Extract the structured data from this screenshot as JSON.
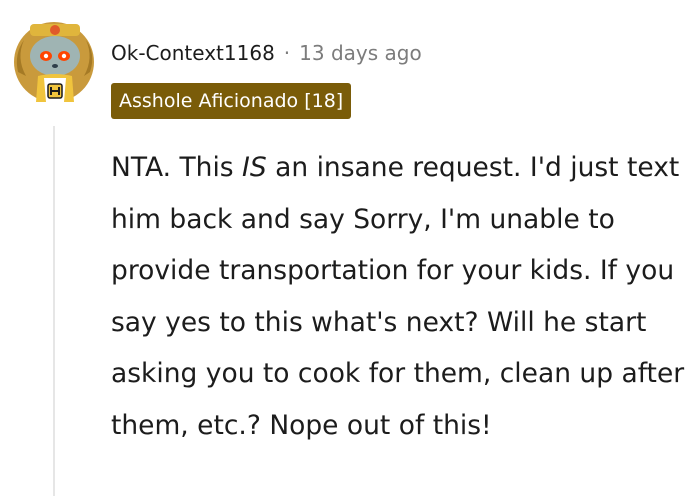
{
  "comment": {
    "author": "Ok-Context1168",
    "separator": "·",
    "timestamp": "13 days ago",
    "flair": "Asshole Aficionado [18]",
    "avatar_icon": "snoo-avatar-icon",
    "body": {
      "part1": "NTA. This ",
      "emphasis": "IS",
      "part2": " an insane request. I'd just text him back and say Sorry, I'm unable to provide transportation for your kids. If you say yes to this what's next? Will he start asking you to cook for them, clean up after them, etc.? Nope out of this!"
    }
  },
  "colors": {
    "flair_bg": "#7a5c09",
    "text": "#1c1c1c",
    "meta": "#7c7c7c",
    "thread_line": "#e6e6e6"
  }
}
